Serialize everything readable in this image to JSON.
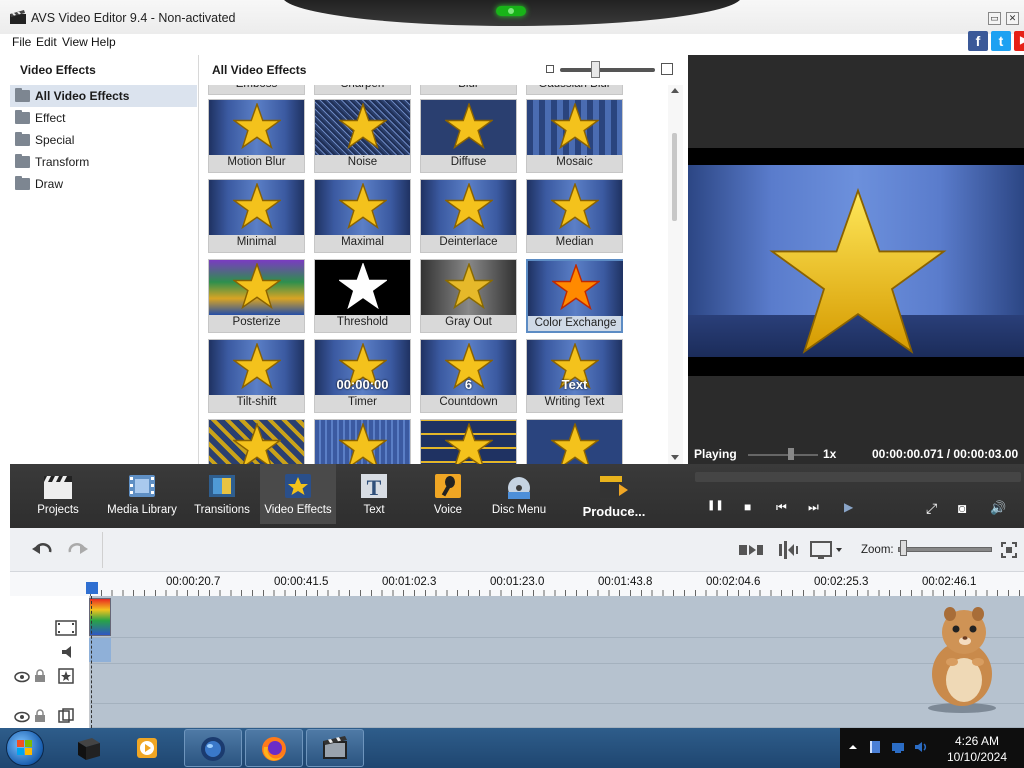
{
  "window": {
    "title": "AVS Video Editor 9.4 - Non-activated",
    "min_glyph": "▭",
    "close_glyph": "✕"
  },
  "menu": [
    "File",
    "Edit",
    "View",
    "Help"
  ],
  "social": [
    {
      "icon": "facebook-icon",
      "glyph": "f",
      "color": "#3b5998"
    },
    {
      "icon": "twitter-icon",
      "glyph": "t",
      "color": "#1da1f2"
    },
    {
      "icon": "youtube-icon",
      "glyph": "▶",
      "color": "#e62117"
    }
  ],
  "left_panel": {
    "title": "Video Effects",
    "items": [
      {
        "label": "All Video Effects",
        "selected": true
      },
      {
        "label": "Effect",
        "selected": false
      },
      {
        "label": "Special",
        "selected": false
      },
      {
        "label": "Transform",
        "selected": false
      },
      {
        "label": "Draw",
        "selected": false
      }
    ]
  },
  "effects_panel": {
    "title": "All Video Effects",
    "partial_row": [
      "Emboss",
      "Sharpen",
      "Blur",
      "Gaussian Blur"
    ],
    "rows": [
      [
        {
          "label": "Motion Blur",
          "variant": "blur"
        },
        {
          "label": "Noise",
          "variant": "noise"
        },
        {
          "label": "Diffuse",
          "variant": "diffuse"
        },
        {
          "label": "Mosaic",
          "variant": "mosaic"
        }
      ],
      [
        {
          "label": "Minimal",
          "variant": "plain"
        },
        {
          "label": "Maximal",
          "variant": "plain"
        },
        {
          "label": "Deinterlace",
          "variant": "plain"
        },
        {
          "label": "Median",
          "variant": "plain"
        }
      ],
      [
        {
          "label": "Posterize",
          "variant": "posterize"
        },
        {
          "label": "Threshold",
          "variant": "threshold"
        },
        {
          "label": "Gray Out",
          "variant": "gray"
        },
        {
          "label": "Color Exchange",
          "variant": "colorx",
          "selected": true
        }
      ],
      [
        {
          "label": "Tilt-shift",
          "variant": "plain"
        },
        {
          "label": "Timer",
          "variant": "plain",
          "overlay": "00:00:00"
        },
        {
          "label": "Countdown",
          "variant": "plain",
          "overlay": "6"
        },
        {
          "label": "Writing Text",
          "variant": "plain",
          "overlay": "Text"
        }
      ]
    ]
  },
  "preview": {
    "status": "Playing",
    "speed": "1x",
    "current_time": "00:00:00.071",
    "separator": "/",
    "total_time": "00:00:03.00"
  },
  "toolbar": [
    {
      "label": "Projects",
      "icon": "clapperboard-icon",
      "active": false
    },
    {
      "label": "Media Library",
      "icon": "film-library-icon",
      "active": false
    },
    {
      "label": "Transitions",
      "icon": "transition-icon",
      "active": false
    },
    {
      "label": "Video Effects",
      "icon": "star-effect-icon",
      "active": true
    },
    {
      "label": "Text",
      "icon": "text-t-icon",
      "active": false
    },
    {
      "label": "Voice",
      "icon": "microphone-icon",
      "active": false
    },
    {
      "label": "Disc Menu",
      "icon": "disc-icon",
      "active": false
    },
    {
      "label": "Produce...",
      "icon": "produce-icon",
      "active": false
    }
  ],
  "playback": [
    {
      "icon": "pause-icon",
      "glyph": "❚❚"
    },
    {
      "icon": "stop-icon",
      "glyph": "■"
    },
    {
      "icon": "previous-frame-icon",
      "glyph": "⏮"
    },
    {
      "icon": "next-frame-icon",
      "glyph": "⏭"
    },
    {
      "icon": "split-view-icon",
      "glyph": "▶"
    },
    {
      "icon": "fullscreen-icon",
      "glyph": "⤢"
    },
    {
      "icon": "snapshot-icon",
      "glyph": "◙"
    },
    {
      "icon": "volume-icon",
      "glyph": "🔊"
    }
  ],
  "timeline": {
    "zoom_label": "Zoom:",
    "ruler": [
      "00:00:20.7",
      "00:00:41.5",
      "00:01:02.3",
      "00:01:23.0",
      "00:01:43.8",
      "00:02:04.6",
      "00:02:25.3",
      "00:02:46.1"
    ]
  },
  "taskbar": {
    "time": "4:26 AM",
    "date": "10/10/2024",
    "apps": [
      {
        "icon": "black-box-app-icon",
        "open": false
      },
      {
        "icon": "media-player-icon",
        "open": false
      },
      {
        "icon": "globe-app-icon",
        "open": true
      },
      {
        "icon": "firefox-icon",
        "open": true
      },
      {
        "icon": "avs-video-editor-icon",
        "open": true
      }
    ]
  }
}
